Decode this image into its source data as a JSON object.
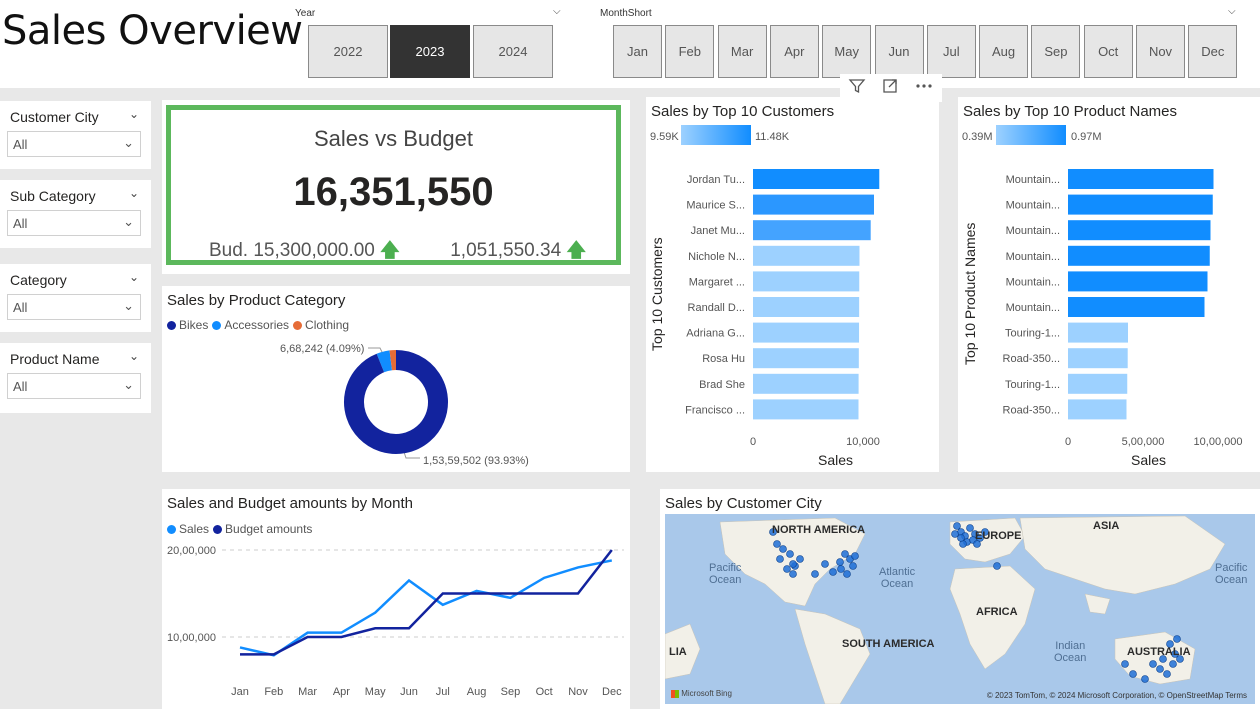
{
  "title": "Sales Overview",
  "year_slicer": {
    "label": "Year",
    "options": [
      "2022",
      "2023",
      "2024"
    ],
    "selected": "2023"
  },
  "month_slicer": {
    "label": "MonthShort",
    "options": [
      "Jan",
      "Feb",
      "Mar",
      "Apr",
      "May",
      "Jun",
      "Jul",
      "Aug",
      "Sep",
      "Oct",
      "Nov",
      "Dec"
    ]
  },
  "filters": [
    {
      "label": "Customer City",
      "value": "All"
    },
    {
      "label": "Sub Category",
      "value": "All"
    },
    {
      "label": "Category",
      "value": "All"
    },
    {
      "label": "Product Name",
      "value": "All"
    }
  ],
  "kpi": {
    "title": "Sales vs Budget",
    "value": "16,351,550",
    "budget": "Bud. 15,300,000.00",
    "variance": "1,051,550.34",
    "arrow": "🡅"
  },
  "visual_header_icons": [
    "filter-icon",
    "focus-mode-icon",
    "more-options-icon"
  ],
  "product_category": {
    "title": "Sales by Product Category",
    "legend": [
      "Bikes",
      "Accessories",
      "Clothing"
    ],
    "label_small": "6,68,242 (4.09%)",
    "label_big": "1,53,59,502 (93.93%)"
  },
  "top_customers": {
    "title": "Sales by Top 10 Customers",
    "gradient_min": "9.59K",
    "gradient_max": "11.48K",
    "ylabel": "Top 10 Customers",
    "xlabel": "Sales",
    "ticks": [
      "0",
      "10,000"
    ]
  },
  "top_products": {
    "title": "Sales by Top 10 Product Names",
    "gradient_min": "0.39M",
    "gradient_max": "0.97M",
    "ylabel": "Top 10 Product Names",
    "xlabel": "Sales",
    "ticks": [
      "0",
      "5,00,000",
      "10,00,000"
    ]
  },
  "monthly": {
    "title": "Sales and Budget amounts by Month",
    "legend": [
      "Sales",
      "Budget amounts"
    ],
    "yticks": [
      "20,00,000",
      "10,00,000"
    ]
  },
  "map": {
    "title": "Sales by Customer City",
    "continents": [
      "NORTH AMERICA",
      "EUROPE",
      "ASIA",
      "AFRICA",
      "SOUTH AMERICA",
      "AUSTRALIA",
      "LIA"
    ],
    "oceans": [
      "Pacific\nOcean",
      "Atlantic\nOcean",
      "Indian\nOcean",
      "Pacific\nOcean"
    ],
    "credits": "© 2023 TomTom, © 2024 Microsoft Corporation, © OpenStreetMap  Terms",
    "bing": "Microsoft Bing"
  },
  "colors": {
    "accent_dark": "#12239e",
    "accent_mid": "#118dff",
    "accent_light": "#9dd1ff",
    "clothing": "#e66c37",
    "kpi_border": "#5cb85c",
    "arrow_up": "#4caf50"
  },
  "chart_data": [
    {
      "type": "pie",
      "title": "Sales by Product Category",
      "categories": [
        "Bikes",
        "Accessories",
        "Clothing"
      ],
      "values": [
        15359502,
        668242,
        323806
      ],
      "percent": [
        93.93,
        4.09,
        1.98
      ]
    },
    {
      "type": "bar",
      "title": "Sales by Top 10 Customers",
      "categories": [
        "Jordan Tu...",
        "Maurice S...",
        "Janet Mu...",
        "Nichole N...",
        "Margaret ...",
        "Randall D...",
        "Adriana G...",
        "Rosa Hu",
        "Brad She",
        "Francisco ..."
      ],
      "values": [
        11480,
        11000,
        10700,
        9680,
        9660,
        9650,
        9640,
        9620,
        9600,
        9590
      ],
      "xlabel": "Sales",
      "ylabel": "Top 10 Customers",
      "xlim": [
        0,
        12000
      ]
    },
    {
      "type": "bar",
      "title": "Sales by Top 10 Product Names",
      "categories": [
        "Mountain...",
        "Mountain...",
        "Mountain...",
        "Mountain...",
        "Mountain...",
        "Mountain...",
        "Touring-1...",
        "Road-350...",
        "Touring-1...",
        "Road-350..."
      ],
      "values": [
        970000,
        965000,
        950000,
        945000,
        930000,
        910000,
        400000,
        398000,
        395000,
        390000
      ],
      "xlabel": "Sales",
      "ylabel": "Top 10 Product Names",
      "xlim": [
        0,
        1050000
      ]
    },
    {
      "type": "line",
      "title": "Sales and Budget amounts by Month",
      "categories": [
        "Jan",
        "Feb",
        "Mar",
        "Apr",
        "May",
        "Jun",
        "Jul",
        "Aug",
        "Sep",
        "Oct",
        "Nov",
        "Dec"
      ],
      "series": [
        {
          "name": "Sales",
          "values": [
            880000,
            790000,
            1050000,
            1050000,
            1280000,
            1650000,
            1370000,
            1530000,
            1450000,
            1680000,
            1800000,
            1880000
          ]
        },
        {
          "name": "Budget amounts",
          "values": [
            800000,
            800000,
            1000000,
            1000000,
            1100000,
            1100000,
            1500000,
            1500000,
            1500000,
            1500000,
            1500000,
            2000000
          ]
        }
      ],
      "ylim": [
        600000,
        2100000
      ]
    }
  ]
}
